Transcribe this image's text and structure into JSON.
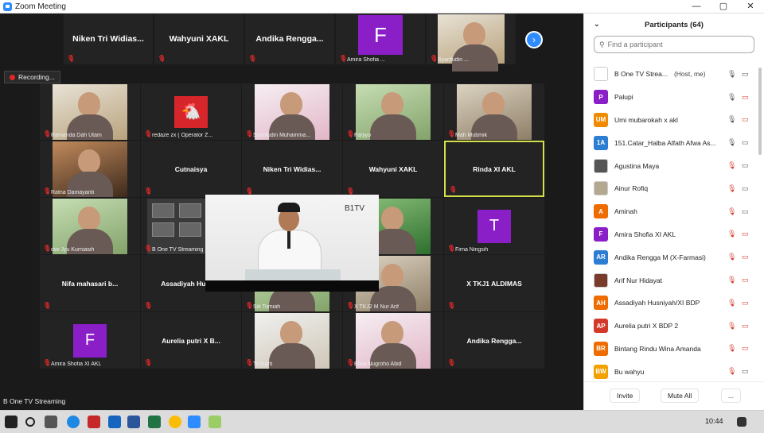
{
  "window": {
    "title": "Zoom Meeting",
    "controls": [
      "—",
      "▢",
      "✕"
    ]
  },
  "top_strip": [
    {
      "label": "Niken Tri Widias..."
    },
    {
      "label": "Wahyuni XAKL"
    },
    {
      "label": "Andika Rengga..."
    },
    {
      "label": "Amira Shofia ...",
      "avatar": "F",
      "avatar_color": "#8a1fc8"
    },
    {
      "label": "Syarifudin ..."
    }
  ],
  "recording": {
    "label": "Recording..."
  },
  "grid": [
    {
      "name": "Ramanda Dah Utam",
      "type": "photo"
    },
    {
      "name": "redaze zx ( Operator Z...",
      "type": "icon"
    },
    {
      "name": "Syarifudin Muhamma...",
      "type": "photo"
    },
    {
      "name": "Farjiyo",
      "type": "photo"
    },
    {
      "name": "Mah Mubmik",
      "type": "photo"
    },
    {
      "name": "Ratna Damayanti",
      "type": "photo"
    },
    {
      "name": "Cutnaisya",
      "type": "text"
    },
    {
      "name": "Niken Tri Widias...",
      "type": "text"
    },
    {
      "name": "Wahyuni XAKL",
      "type": "text"
    },
    {
      "name": "Rinda XI AKL",
      "type": "text",
      "selected": true
    },
    {
      "name": "dwi Jyu Kurniasih",
      "type": "photo"
    },
    {
      "name": "B One TV Streaming",
      "type": "screen"
    },
    {
      "name": "",
      "type": "hidden"
    },
    {
      "name": "",
      "type": "photo"
    },
    {
      "name": "Firna Ningsih",
      "type": "avatar",
      "avatar": "T",
      "avatar_color": "#8a1fc8"
    },
    {
      "name": "Nifa mahasari b...",
      "type": "text"
    },
    {
      "name": "Assadiyah Husni...",
      "type": "text"
    },
    {
      "name": "Siti Tomiah",
      "type": "photo"
    },
    {
      "name": "X TKJ2 M Nur Arif",
      "type": "photo"
    },
    {
      "name": "X TKJ1 ALDIMAS",
      "type": "text"
    },
    {
      "name": "Amira Shofia XI AKL",
      "type": "avatar",
      "avatar": "F",
      "avatar_color": "#8a1fc8"
    },
    {
      "name": "Aurelia putri X B...",
      "type": "text"
    },
    {
      "name": "Tri Kurti",
      "type": "photo"
    },
    {
      "name": "Elisa Nugroho Abid",
      "type": "photo"
    },
    {
      "name": "Andika Rengga...",
      "type": "text"
    }
  ],
  "featured": {
    "logo": "B1TV",
    "label": "B One TV Streaming"
  },
  "participants": {
    "title": "Participants (64)",
    "search_placeholder": "Find a participant",
    "list": [
      {
        "name": "B One TV Strea...",
        "role": "(Host, me)",
        "initials": "",
        "color": "#ffffff",
        "mic": "on",
        "cam": "on"
      },
      {
        "name": "Palupi",
        "initials": "P",
        "color": "#8a1fc8",
        "mic": "on",
        "cam": "off"
      },
      {
        "name": "Umi mubarokah x akl",
        "initials": "UM",
        "color": "#f08a00",
        "mic": "on",
        "cam": "off"
      },
      {
        "name": "151.Catar_Halba Alfath Afwa As...",
        "initials": "1A",
        "color": "#2d7dd2",
        "mic": "on",
        "cam": "on"
      },
      {
        "name": "Agustina Maya",
        "initials": "",
        "color": "#555555",
        "mic": "off",
        "cam": "on"
      },
      {
        "name": "Ainur Rofiq",
        "initials": "",
        "color": "#b5a890",
        "mic": "off",
        "cam": "on"
      },
      {
        "name": "Aminah",
        "initials": "A",
        "color": "#ef6c00",
        "mic": "off",
        "cam": "on"
      },
      {
        "name": "Amira Shofia XI AKL",
        "initials": "F",
        "color": "#8a1fc8",
        "mic": "off",
        "cam": "off"
      },
      {
        "name": "Andika Rengga M (X-Farmasi)",
        "initials": "AR",
        "color": "#2d7dd2",
        "mic": "off",
        "cam": "off"
      },
      {
        "name": "Arif Nur Hidayat",
        "initials": "",
        "color": "#7a3b2a",
        "mic": "off",
        "cam": "off"
      },
      {
        "name": "Assadiyah Husniyah/XI BDP",
        "initials": "AH",
        "color": "#ef6c00",
        "mic": "off",
        "cam": "off"
      },
      {
        "name": "Aurelia putri X BDP 2",
        "initials": "AP",
        "color": "#d43a2a",
        "mic": "off",
        "cam": "off"
      },
      {
        "name": "Bintang Rindu Wina Amanda",
        "initials": "BR",
        "color": "#ef6c00",
        "mic": "off",
        "cam": "off"
      },
      {
        "name": "Bu wahyu",
        "initials": "BW",
        "color": "#f2a100",
        "mic": "off",
        "cam": "on"
      }
    ],
    "invite_label": "Invite",
    "mute_all_label": "Mute All",
    "more_label": "..."
  },
  "taskbar": {
    "time": "10:44"
  }
}
